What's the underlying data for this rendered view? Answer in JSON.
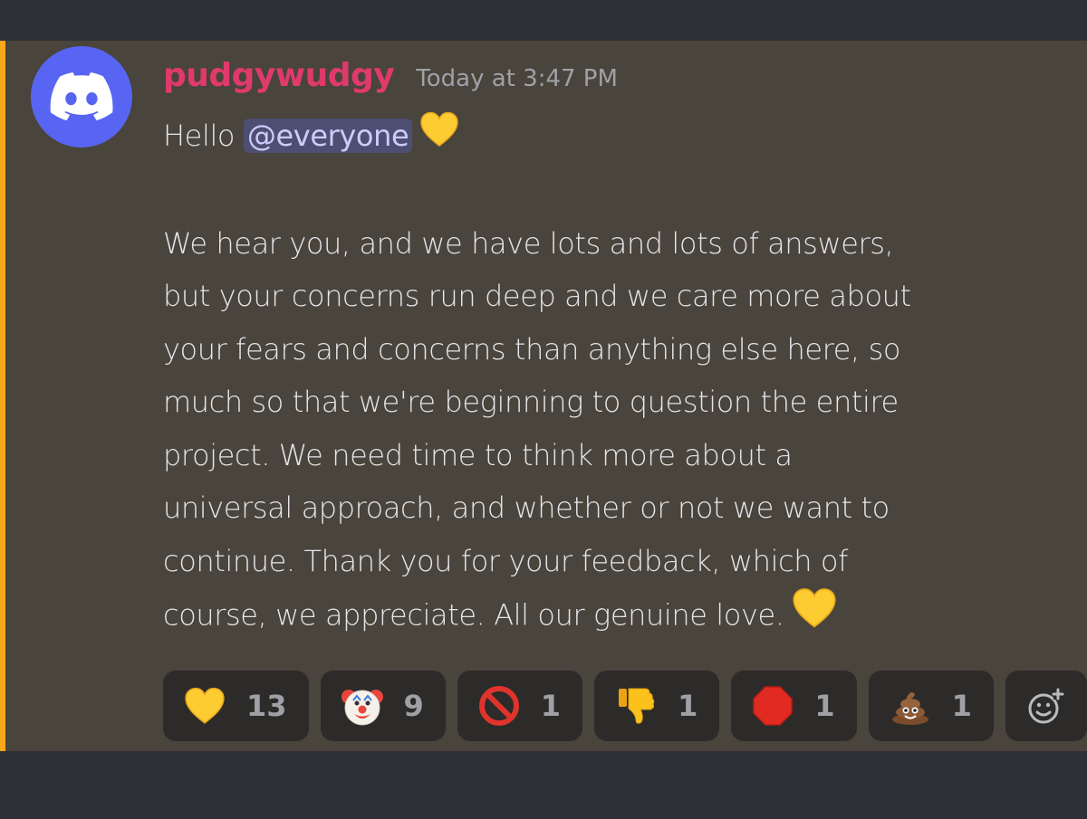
{
  "message": {
    "author": "pudgywudgy",
    "timestamp": "Today at 3:47 PM",
    "greeting": "Hello",
    "mention": "@everyone",
    "lines": [
      "We hear you, and we have lots and lots of answers,",
      "but your concerns run deep and we care more about",
      "your fears and concerns than anything else here, so",
      "much so that we're beginning to question the entire",
      "project. We need time to think more about a",
      "universal approach, and whether or not we want to",
      "continue. Thank you for your feedback, which of",
      "course, we appreciate. All our genuine love."
    ]
  },
  "reactions": [
    {
      "emoji": "yellow-heart",
      "count": "13"
    },
    {
      "emoji": "clown-face",
      "count": "9"
    },
    {
      "emoji": "prohibited-sign",
      "count": "1"
    },
    {
      "emoji": "thumbs-down",
      "count": "1"
    },
    {
      "emoji": "stop-sign",
      "count": "1"
    },
    {
      "emoji": "pile-of-poo",
      "count": "1"
    }
  ],
  "colors": {
    "message_bg": "#49443c",
    "highlight_bar": "#faa81a",
    "username": "#e03a6b",
    "avatar_bg": "#5865f2",
    "mention_bg": "#4e4e73"
  }
}
